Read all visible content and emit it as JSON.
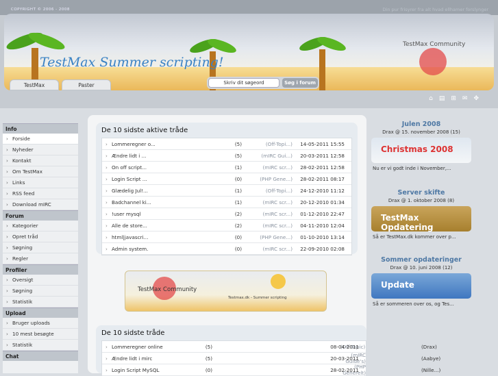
{
  "header": {
    "copyright": "COPYRIGHT © 2006 - 2008",
    "tagline": "Din pur frisyrer fra alt hvad ellhamer forslynger",
    "banner_title": "TestMax Summer scripting!",
    "logo_text": "TestMax Community",
    "tabs": [
      "TestMax",
      "Paster"
    ],
    "search_placeholder": "Skriv dit søgeord",
    "search_button": "Søg i forum"
  },
  "sidebar": [
    {
      "title": "Info",
      "items": [
        "Forside",
        "Nyheder",
        "Kontakt",
        "Om TestMax",
        "Links",
        "RSS feed",
        "Download mIRC"
      ]
    },
    {
      "title": "Forum",
      "items": [
        "Kategorier",
        "Opret tråd",
        "Søgning",
        "Regler"
      ]
    },
    {
      "title": "Profiler",
      "items": [
        "Oversigt",
        "Søgning",
        "Statistik"
      ]
    },
    {
      "title": "Upload",
      "items": [
        "Bruger uploads",
        "10 mest besøgte",
        "Statistik"
      ]
    },
    {
      "title": "Chat",
      "items": []
    }
  ],
  "active_threads": {
    "title": "De 10 sidste aktive tråde",
    "rows": [
      [
        "Lommeregner o...",
        "(5)",
        "(Off-Topi...)",
        "14-05-2011 15:55"
      ],
      [
        "Ændre lidt i ...",
        "(5)",
        "(mIRC Gui...)",
        "20-03-2011 12:58"
      ],
      [
        "On off script...",
        "(1)",
        "(mIRC scr...)",
        "28-02-2011 12:58"
      ],
      [
        "Login Script ...",
        "(0)",
        "(PHP Gene...)",
        "28-02-2011 08:17"
      ],
      [
        "Glædelig Jul!...",
        "(1)",
        "(Off-Topi...)",
        "24-12-2010 11:12"
      ],
      [
        "Badchannel ki...",
        "(1)",
        "(mIRC scr...)",
        "20-12-2010 01:34"
      ],
      [
        "!user mysql",
        "(2)",
        "(mIRC scr...)",
        "01-12-2010 22:47"
      ],
      [
        "Alle de store...",
        "(2)",
        "(mIRC scr...)",
        "04-11-2010 12:04"
      ],
      [
        "html|javascri...",
        "(0)",
        "(PHP Gene...)",
        "01-10-2010 13:14"
      ],
      [
        "Admin system.",
        "(0)",
        "(mIRC scr...)",
        "22-09-2010 02:08"
      ]
    ]
  },
  "ad_banner": {
    "logo": "TestMax Community",
    "small": "Testmax.dk - Summer scripting"
  },
  "latest_threads": {
    "title": "De 10 sidste tråde",
    "rows": [
      [
        "Lommeregner online",
        "(5)",
        "(Off-Topic)",
        "(Drax)",
        "08-04-2011"
      ],
      [
        "Ændre lidt i mirc",
        "(5)",
        "(mIRC Guide's)",
        "(Aabye)",
        "20-03-2011"
      ],
      [
        "Login Script MySQL",
        "(0)",
        "(PHP Generelt)",
        "(Nille...)",
        "28-02-2011"
      ]
    ]
  },
  "news": [
    {
      "title": "Julen 2008",
      "meta": "Drax @ 15. november 2008 (15)",
      "img": "Christmas 2008",
      "excerpt": "Nu er vi godt inde i November,..."
    },
    {
      "title": "Server skifte",
      "meta": "Drax @ 1. oktober 2008 (8)",
      "img": "TestMax Opdatering",
      "excerpt": "Så er TestMax.dk kommer over p..."
    },
    {
      "title": "Sommer opdateringer",
      "meta": "Drax @ 10. juni 2008 (12)",
      "img": "Update",
      "excerpt": "Så er sommeren over os, og Tes..."
    }
  ],
  "colors": {
    "accent": "#3a82c4",
    "news_title": "#4e78a4"
  }
}
